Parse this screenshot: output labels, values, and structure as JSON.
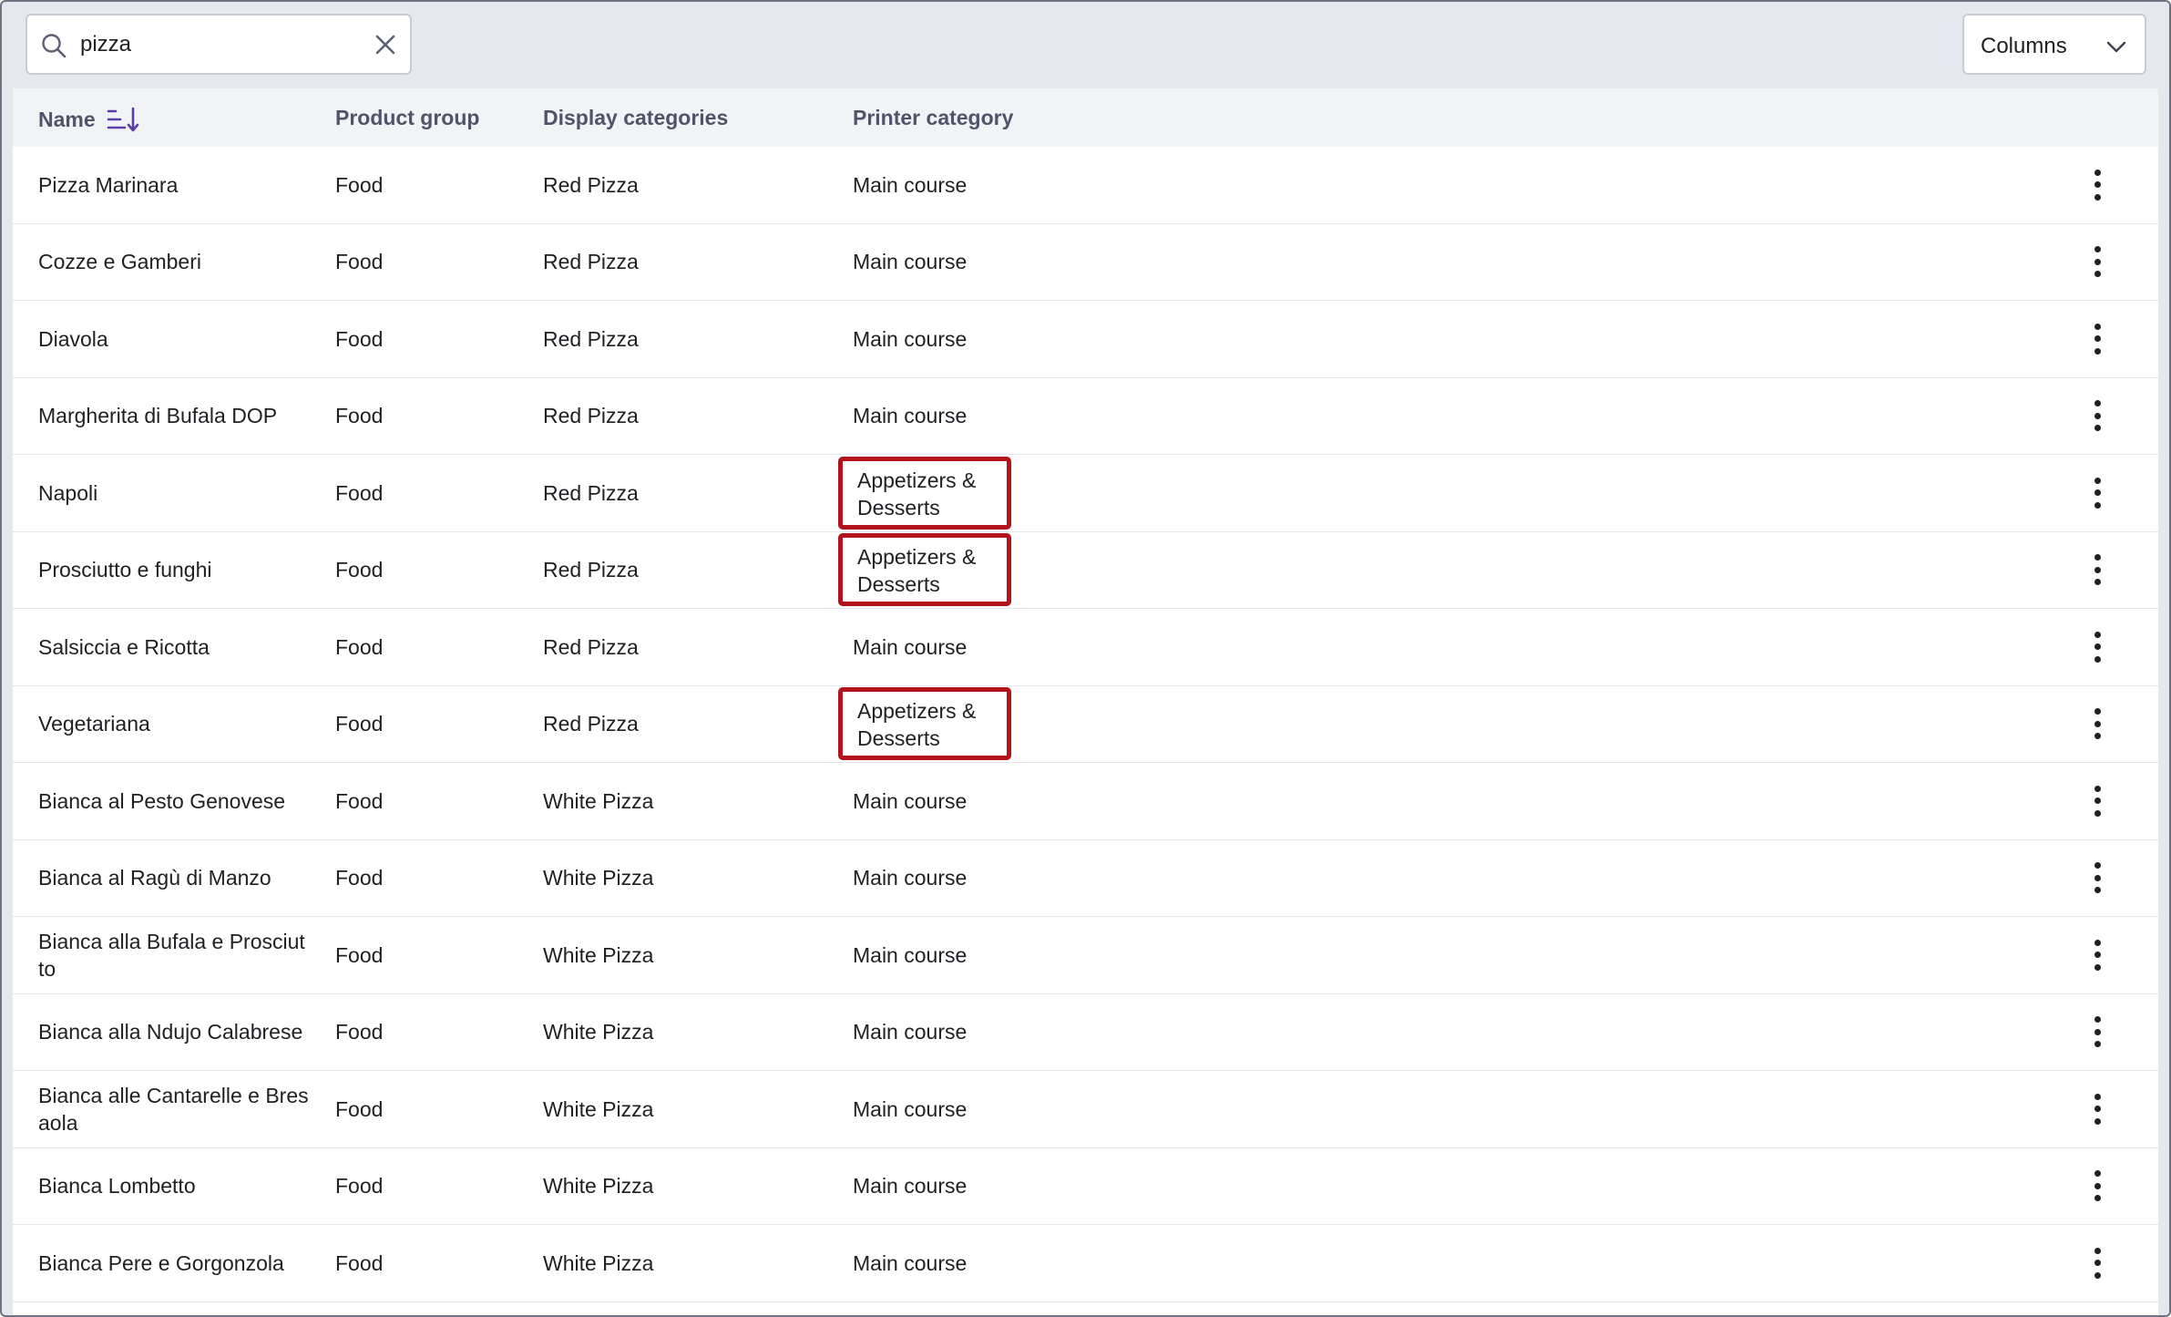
{
  "search": {
    "value": "pizza",
    "icon": "search-icon",
    "clear_icon": "close-icon"
  },
  "columns_button": {
    "label": "Columns",
    "icon": "chevron-down-icon"
  },
  "table": {
    "headers": {
      "name": "Name",
      "product_group": "Product group",
      "display_categories": "Display categories",
      "printer_category": "Printer category"
    },
    "sort_icon": "sort-descending-icon",
    "highlight_color": "#b3141c",
    "rows": [
      {
        "name": "Pizza Marinara",
        "product_group": "Food",
        "display_categories": "Red Pizza",
        "printer_category": "Main course",
        "highlighted": false
      },
      {
        "name": "Cozze e Gamberi",
        "product_group": "Food",
        "display_categories": "Red Pizza",
        "printer_category": "Main course",
        "highlighted": false
      },
      {
        "name": "Diavola",
        "product_group": "Food",
        "display_categories": "Red Pizza",
        "printer_category": "Main course",
        "highlighted": false
      },
      {
        "name": "Margherita di Bufala DOP",
        "product_group": "Food",
        "display_categories": "Red Pizza",
        "printer_category": "Main course",
        "highlighted": false
      },
      {
        "name": "Napoli",
        "product_group": "Food",
        "display_categories": "Red Pizza",
        "printer_category": "Appetizers & Desserts",
        "highlighted": true
      },
      {
        "name": "Prosciutto e funghi",
        "product_group": "Food",
        "display_categories": "Red Pizza",
        "printer_category": "Appetizers & Desserts",
        "highlighted": true
      },
      {
        "name": "Salsiccia e Ricotta",
        "product_group": "Food",
        "display_categories": "Red Pizza",
        "printer_category": "Main course",
        "highlighted": false
      },
      {
        "name": "Vegetariana",
        "product_group": "Food",
        "display_categories": "Red Pizza",
        "printer_category": "Appetizers & Desserts",
        "highlighted": true
      },
      {
        "name": "Bianca al Pesto Genovese",
        "product_group": "Food",
        "display_categories": "White Pizza",
        "printer_category": "Main course",
        "highlighted": false
      },
      {
        "name": "Bianca al Ragù di Manzo",
        "product_group": "Food",
        "display_categories": "White Pizza",
        "printer_category": "Main course",
        "highlighted": false
      },
      {
        "name": "Bianca alla Bufala e Prosciut to",
        "product_group": "Food",
        "display_categories": "White Pizza",
        "printer_category": "Main course",
        "highlighted": false
      },
      {
        "name": "Bianca alla Ndujo Calabrese",
        "product_group": "Food",
        "display_categories": "White Pizza",
        "printer_category": "Main course",
        "highlighted": false
      },
      {
        "name": "Bianca alle Cantarelle e Bres aola",
        "product_group": "Food",
        "display_categories": "White Pizza",
        "printer_category": "Main course",
        "highlighted": false
      },
      {
        "name": "Bianca Lombetto",
        "product_group": "Food",
        "display_categories": "White Pizza",
        "printer_category": "Main course",
        "highlighted": false
      },
      {
        "name": "Bianca Pere e Gorgonzola",
        "product_group": "Food",
        "display_categories": "White Pizza",
        "printer_category": "Main course",
        "highlighted": false
      }
    ],
    "row_menu_icon": "more-vertical-icon"
  }
}
